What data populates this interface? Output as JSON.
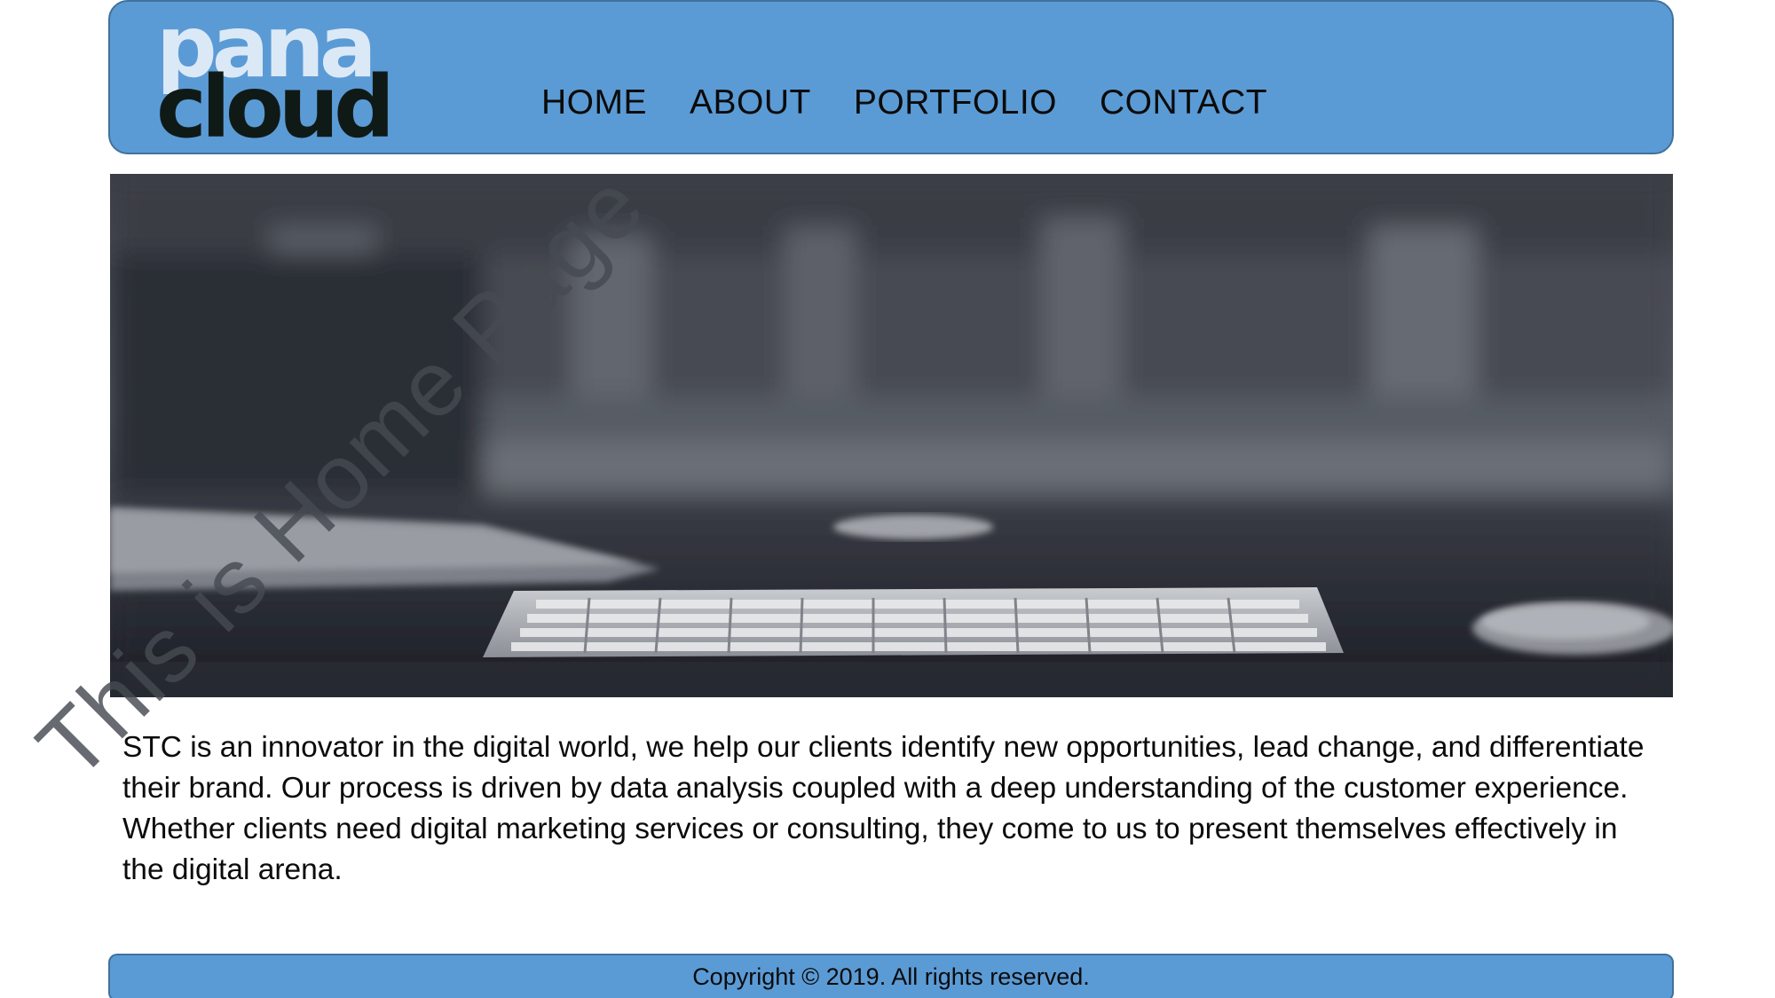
{
  "logo": {
    "line1": "pana",
    "line2": "cloud",
    "line1_color": "#dbe9f7",
    "line2_color": "#0f1a17"
  },
  "nav": {
    "items": [
      {
        "label": "HOME"
      },
      {
        "label": "ABOUT"
      },
      {
        "label": "PORTFOLIO"
      },
      {
        "label": "CONTACT"
      }
    ]
  },
  "hero": {
    "image": "desk-keyboard-photo",
    "watermark": "This is Home Page"
  },
  "intro": {
    "text": "STC is an innovator in the digital world, we help our clients identify new opportunities, lead change, and differentiate their brand. Our process is driven by data analysis coupled with a deep understanding of the customer experience. Whether clients need digital marketing services or consulting, they come to us to present themselves effectively in the digital arena."
  },
  "footer": {
    "copyright": "Copyright © 2019. All rights reserved."
  },
  "colors": {
    "header_bg": "#5b9bd5",
    "header_border": "#41719c",
    "footer_bg": "#5b9bd5",
    "text": "#0b0b0b"
  }
}
